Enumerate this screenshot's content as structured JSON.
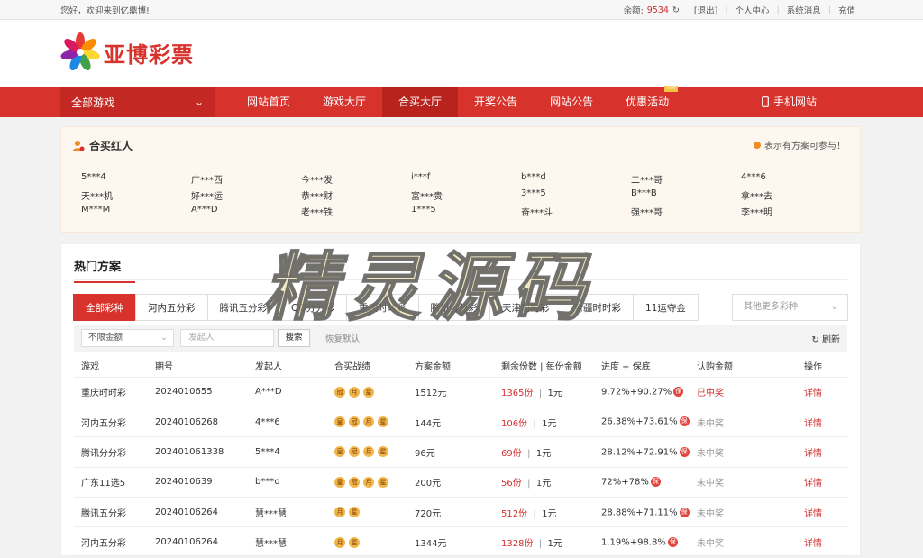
{
  "topbar": {
    "greeting": "您好，欢迎来到亿鼎博!",
    "balance_label": "余额:",
    "balance": "9534",
    "logout": "[退出]",
    "personal": "个人中心",
    "messages": "系统消息",
    "recharge": "充值"
  },
  "logo": {
    "text": "亚博彩票"
  },
  "nav": {
    "all_games": "全部游戏",
    "items": [
      "网站首页",
      "游戏大厅",
      "合买大厅",
      "开奖公告",
      "网站公告",
      "优惠活动"
    ],
    "hot_badge": "HOT",
    "mobile": "手机网站"
  },
  "redpanel": {
    "title": "合买红人",
    "note": "表示有方案可参与！",
    "names": [
      "5***4",
      "广***西",
      "今***发",
      "i***f",
      "b***d",
      "二***哥",
      "4***6",
      "天***机",
      "好***运",
      "恭***财",
      "富***贵",
      "3***5",
      "B***B",
      "拿***去",
      "M***M",
      "A***D",
      "老***铁",
      "1***5",
      "奋***斗",
      "强***哥",
      "李***明"
    ]
  },
  "hot": {
    "title": "热门方案",
    "tabs": [
      "全部彩种",
      "河内五分彩",
      "腾讯五分彩",
      "QQ分分彩",
      "重庆时时彩",
      "腾讯分分彩",
      "天津时时彩",
      "新疆时时彩",
      "11运夺金"
    ],
    "more": "其他更多彩种",
    "filter": {
      "amount": "不限金额",
      "initiator_placeholder": "发起人",
      "search": "搜索",
      "reset": "恢复默认",
      "refresh": "刷新"
    },
    "columns": [
      "游戏",
      "期号",
      "发起人",
      "合买战绩",
      "方案金额",
      "剩余份数 | 每份金额",
      "进度 + 保底",
      "认购金额",
      "操作"
    ],
    "rows": [
      {
        "game": "重庆时时彩",
        "issue": "2024010655",
        "user": "A***D",
        "amount": "1512元",
        "left": "1365份",
        "per": "1元",
        "progress": "9.72%+90.27%",
        "status": "已中奖",
        "won": true,
        "op": "详情",
        "badges": [
          "冠",
          "月",
          "星"
        ]
      },
      {
        "game": "河内五分彩",
        "issue": "20240106268",
        "user": "4***6",
        "amount": "144元",
        "left": "106份",
        "per": "1元",
        "progress": "26.38%+73.61%",
        "status": "未中奖",
        "won": false,
        "op": "详情",
        "badges": [
          "皇",
          "冠",
          "月",
          "星"
        ]
      },
      {
        "game": "腾讯分分彩",
        "issue": "20240106133​8",
        "user": "5***4",
        "amount": "96元",
        "left": "69份",
        "per": "1元",
        "progress": "28.12%+72.91%",
        "status": "未中奖",
        "won": false,
        "op": "详情",
        "badges": [
          "皇",
          "冠",
          "月",
          "星"
        ]
      },
      {
        "game": "广东11选5",
        "issue": "2024010639",
        "user": "b***d",
        "amount": "200元",
        "left": "56份",
        "per": "1元",
        "progress": "72%+78%",
        "status": "未中奖",
        "won": false,
        "op": "详情",
        "badges": [
          "皇",
          "冠",
          "月",
          "星"
        ]
      },
      {
        "game": "腾讯五分彩",
        "issue": "20240106264",
        "user": "慧***慧",
        "amount": "720元",
        "left": "512份",
        "per": "1元",
        "progress": "28.88%+71.11%",
        "status": "未中奖",
        "won": false,
        "op": "详情",
        "badges": [
          "月",
          "星"
        ]
      },
      {
        "game": "河内五分彩",
        "issue": "20240106264",
        "user": "慧***慧",
        "amount": "1344元",
        "left": "1328份",
        "per": "1元",
        "progress": "1.19%+98.8%",
        "status": "未中奖",
        "won": false,
        "op": "详情",
        "badges": [
          "月",
          "星"
        ]
      }
    ],
    "bao": "保"
  },
  "watermark": "精灵源码"
}
